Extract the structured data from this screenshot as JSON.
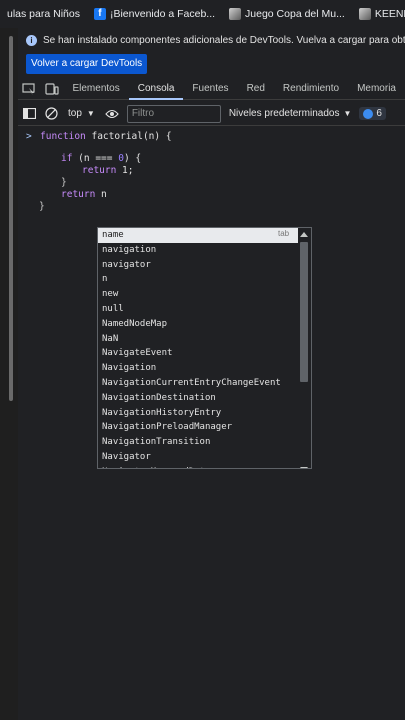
{
  "bookmarks": [
    {
      "label": "ulas para Niños",
      "icon": "none"
    },
    {
      "label": "¡Bienvenido a Faceb...",
      "icon": "facebook-icon"
    },
    {
      "label": "Juego Copa del Mu...",
      "icon": "game-icon"
    },
    {
      "label": "KEENNETH - (",
      "icon": "game-icon"
    }
  ],
  "infobar": {
    "message": "Se han instalado componentes adicionales de DevTools. Vuelva a cargar para obtener",
    "button": "Volver a cargar DevTools"
  },
  "tabs": [
    "Elementos",
    "Consola",
    "Fuentes",
    "Red",
    "Rendimiento",
    "Memoria"
  ],
  "active_tab": "Consola",
  "toolbar": {
    "context": "top",
    "filter_placeholder": "Filtro",
    "levels": "Niveles predeterminados",
    "issues_count": "6"
  },
  "code": {
    "line1_kw": "function",
    "line1_rest": " factorial(n) {",
    "line2_if": "if",
    "line2_rest": " (n === ",
    "line2_num": "0",
    "line2_end": ") {",
    "line3_kw": "return",
    "line3_rest": " 1;",
    "line4": "}",
    "line5_kw": "return",
    "line5_rest": " n",
    "line6": "}"
  },
  "autocomplete": {
    "hint": "tab",
    "items": [
      "name",
      "navigation",
      "navigator",
      "n",
      "new",
      "null",
      "NamedNodeMap",
      "NaN",
      "NavigateEvent",
      "Navigation",
      "NavigationCurrentEntryChangeEvent",
      "NavigationDestination",
      "NavigationHistoryEntry",
      "NavigationPreloadManager",
      "NavigationTransition",
      "Navigator",
      "NavigatorManagedData"
    ]
  },
  "colors": {
    "accent": "#a8c7fa",
    "button": "#0b57d0",
    "keyword": "#c58af9",
    "number": "#9980ff"
  }
}
